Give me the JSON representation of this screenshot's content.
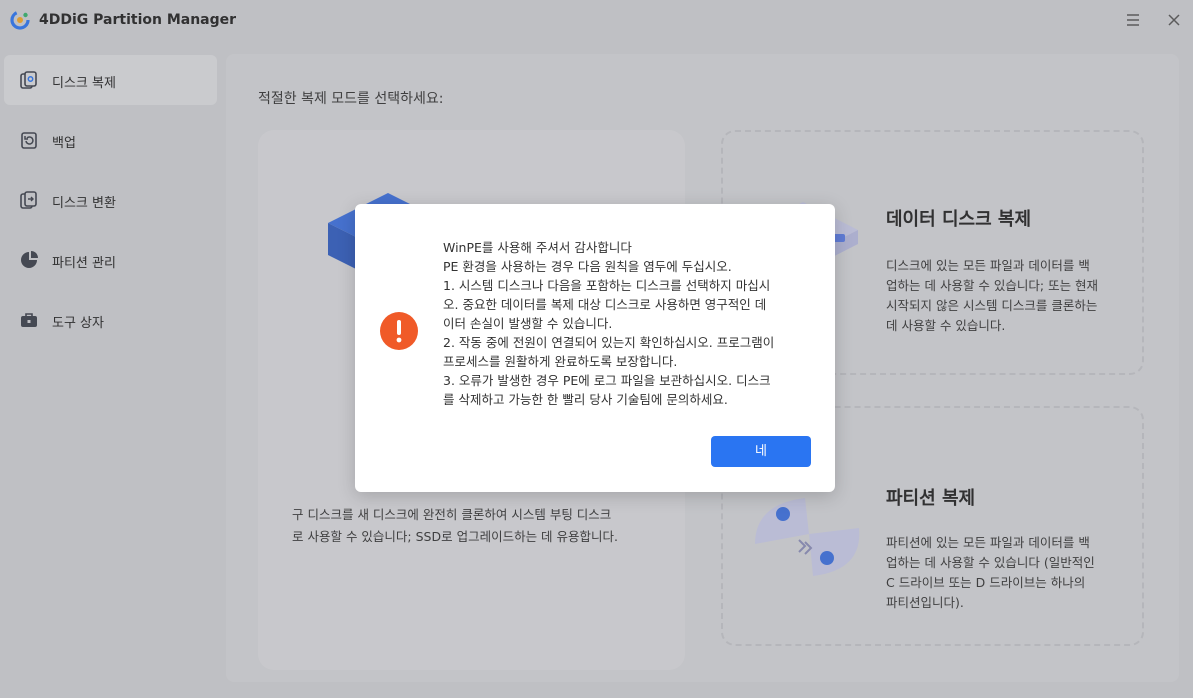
{
  "app": {
    "title": "4DDiG Partition Manager"
  },
  "sidebar": {
    "items": [
      {
        "label": "디스크 복제",
        "icon": "disk-clone-icon"
      },
      {
        "label": "백업",
        "icon": "backup-icon"
      },
      {
        "label": "디스크 변환",
        "icon": "disk-convert-icon"
      },
      {
        "label": "파티션 관리",
        "icon": "partition-manage-icon"
      },
      {
        "label": "도구 상자",
        "icon": "toolbox-icon"
      }
    ]
  },
  "main": {
    "title": "적절한 복제 모드를 선택하세요:",
    "system_clone": {
      "desc": [
        "구 디스크를 새 디스크에 완전히 클론하여 시스템 부팅 디스크",
        "로 사용할 수 있습니다; SSD로 업그레이드하는 데 유용합니다."
      ]
    },
    "data_clone": {
      "title": "데이터 디스크 복제",
      "desc": [
        "디스크에 있는 모든 파일과 데이터를 백",
        "업하는 데 사용할 수 있습니다; 또는 현재",
        "시작되지 않은 시스템 디스크를 클론하는",
        "데 사용할 수 있습니다."
      ]
    },
    "partition_clone": {
      "title": "파티션 복제",
      "desc": [
        "파티션에 있는 모든 파일과 데이터를 백",
        "업하는 데 사용할 수 있습니다 (일반적인",
        "C 드라이브 또는 D 드라이브는 하나의",
        "파티션입니다)."
      ]
    }
  },
  "modal": {
    "lines": [
      "WinPE를 사용해 주셔서 감사합니다",
      "PE 환경을 사용하는 경우 다음 원칙을 염두에 두십시오.",
      "1. 시스템 디스크나 다음을 포함하는 디스크를 선택하지 마십시",
      "오. 중요한 데이터를 복제 대상 디스크로 사용하면 영구적인 데",
      "이터 손실이 발생할 수 있습니다.",
      "2. 작동 중에 전원이 연결되어 있는지 확인하십시오. 프로그램이",
      "프로세스를 원활하게 완료하도록 보장합니다.",
      "3. 오류가 발생한 경우 PE에 로그 파일을 보관하십시오. 디스크",
      "를 삭제하고 가능한 한 빨리 당사 기술팀에 문의하세요."
    ],
    "ok_label": "네"
  },
  "colors": {
    "accent": "#2a75f2",
    "warning": "#f05a28",
    "background": "#cfd0d3"
  }
}
